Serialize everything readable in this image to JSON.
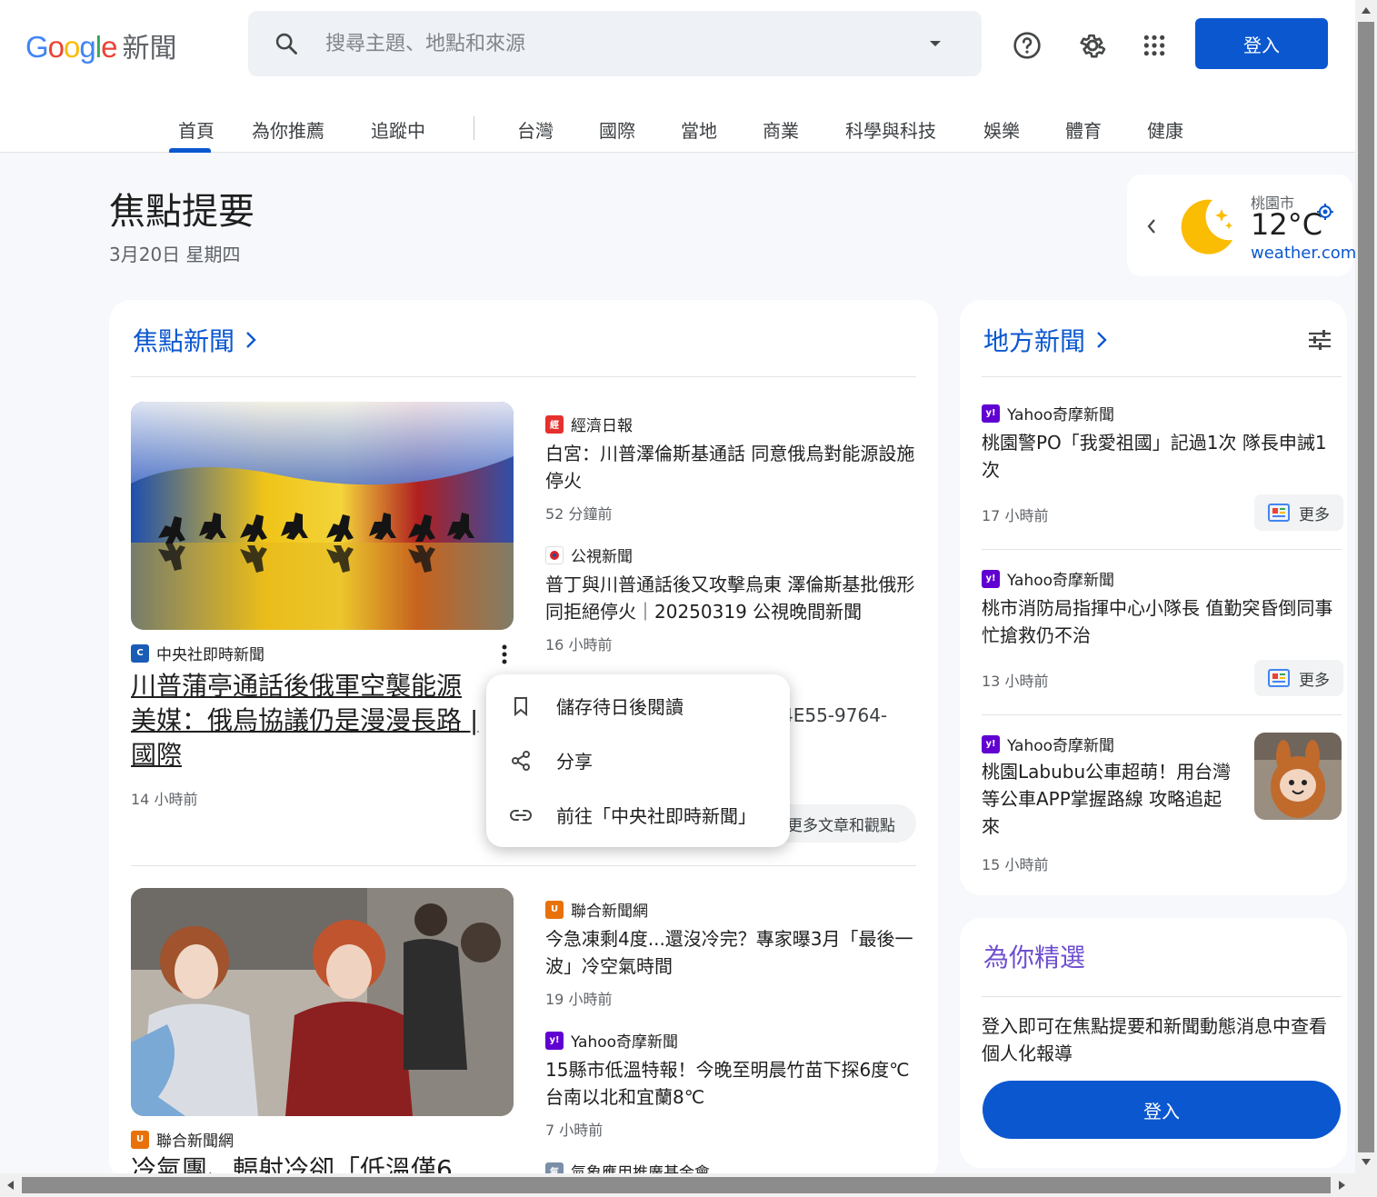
{
  "header": {
    "logo_word": "Google",
    "logo_suffix": "新聞",
    "search_placeholder": "搜尋主題、地點和來源",
    "signin_label": "登入"
  },
  "icons": {
    "search": "search-icon",
    "dropdown": "chevron-down-icon",
    "help": "help-icon",
    "settings": "gear-icon",
    "apps": "apps-grid-icon"
  },
  "nav": {
    "tabs": [
      "首頁",
      "為你推薦",
      "追蹤中",
      "台灣",
      "國際",
      "當地",
      "商業",
      "科學與科技",
      "娛樂",
      "體育",
      "健康"
    ]
  },
  "briefing": {
    "title": "焦點提要",
    "date": "3月20日 星期四"
  },
  "weather": {
    "city": "桃園市",
    "temp": "12°C",
    "source": "weather.com"
  },
  "top_stories": {
    "title": "焦點新聞",
    "main": {
      "publisher": "中央社即時新聞",
      "headline": "川普蒲亭通話後俄軍空襲能源 美媒：俄烏協議仍是漫漫長路 | 國際",
      "time": "14 小時前"
    },
    "side": [
      {
        "publisher": "經濟日報",
        "headline": "白宮：川普澤倫斯基通話 同意俄烏對能源設施停火",
        "time": "52 分鐘前"
      },
      {
        "publisher": "公視新聞",
        "headline": "普丁與川普通話後又攻擊烏東 澤倫斯基批俄形同拒絕停火｜20250319 公視晚間新聞",
        "time": "16 小時前"
      }
    ],
    "obscured_text": "4E55-9764-",
    "full_coverage": "更多文章和觀點",
    "second_main": {
      "publisher": "聯合新聞網",
      "headline": "冷氣團、輻射冷卻「低溫僅6"
    },
    "second_side": [
      {
        "publisher": "聯合新聞網",
        "headline": "今急凍剩4度...還沒冷完？專家曝3月「最後一波」冷空氣時間",
        "time": "19 小時前"
      },
      {
        "publisher": "Yahoo奇摩新聞",
        "headline": "15縣市低溫特報！今晚至明晨竹苗下探6度℃ 台南以北和宜蘭8℃",
        "time": "7 小時前"
      },
      {
        "publisher": "氣象應用推廣基金會",
        "headline": "",
        "time": ""
      }
    ]
  },
  "menu": {
    "items": [
      "儲存待日後閱讀",
      "分享",
      "前往「中央社即時新聞」"
    ]
  },
  "local": {
    "title": "地方新聞",
    "items": [
      {
        "publisher": "Yahoo奇摩新聞",
        "headline": "桃園警PO「我愛祖國」記過1次 隊長申誡1次",
        "time": "17 小時前",
        "more": "更多"
      },
      {
        "publisher": "Yahoo奇摩新聞",
        "headline": "桃市消防局指揮中心小隊長 值勤突昏倒同事忙搶救仍不治",
        "time": "13 小時前",
        "more": "更多"
      },
      {
        "publisher": "Yahoo奇摩新聞",
        "headline": "桃園Labubu公車超萌！用台灣等公車APP掌握路線 攻略追起來",
        "time": "15 小時前"
      }
    ]
  },
  "for_you": {
    "title": "為你精選",
    "text": "登入即可在焦點提要和新聞動態消息中查看個人化報導",
    "signin_label": "登入"
  },
  "colors": {
    "accent": "#0b57d0",
    "purple_title": "#6f4fd0",
    "yahoo": "#6001d2",
    "udn": "#e8710a"
  }
}
